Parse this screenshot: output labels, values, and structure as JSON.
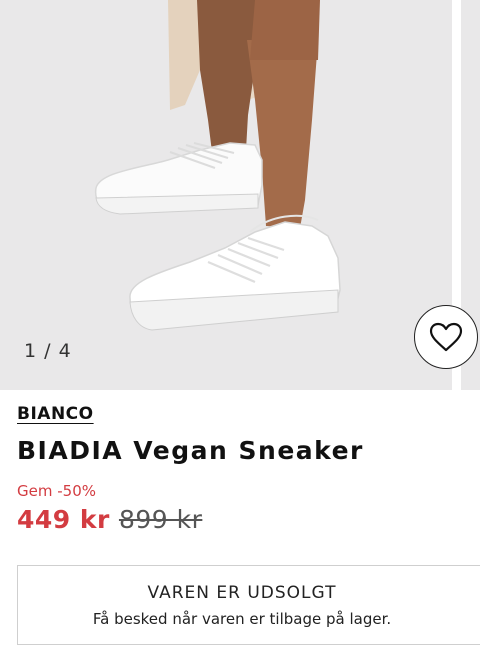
{
  "gallery": {
    "counter": "1 / 4",
    "image_alt": "BIADIA Vegan Sneaker"
  },
  "wishlist": {
    "icon": "heart-icon"
  },
  "product": {
    "brand": "BIANCO",
    "title": "BIADIA Vegan Sneaker",
    "discount_label": "Gem -50%",
    "price": "449 kr",
    "original_price": "899 kr"
  },
  "availability": {
    "title": "VAREN ER UDSOLGT",
    "subtitle": "Få besked når varen er tilbage på lager."
  },
  "colors": {
    "sale_red": "#d33c41",
    "image_bg": "#e9e8e9",
    "text": "#111111"
  }
}
